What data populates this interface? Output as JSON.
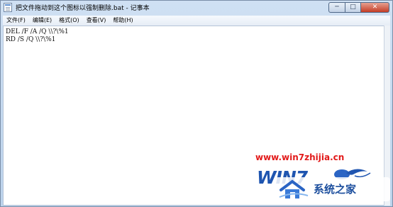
{
  "window": {
    "title": "把文件拖动到这个图标以强制删除.bat - 记事本",
    "caption_buttons": {
      "minimize": "─",
      "maximize": "□",
      "close": "✕"
    }
  },
  "menu": {
    "items": [
      "文件(F)",
      "编辑(E)",
      "格式(O)",
      "查看(V)",
      "帮助(H)"
    ]
  },
  "editor": {
    "lines": [
      "DEL /F /A /Q \\\\?\\%1",
      "RD /S /Q \\\\?\\%1"
    ]
  },
  "watermark": {
    "url": "www.win7zhijia.cn",
    "logo_text": "WIN7",
    "brand": "系统之家"
  },
  "colors": {
    "titlebar": "#cfe0f3",
    "close_button": "#c43c26",
    "watermark_url": "#e21a1a",
    "watermark_logo": "#1f55b0"
  },
  "icons": {
    "app": "notepad-icon"
  }
}
